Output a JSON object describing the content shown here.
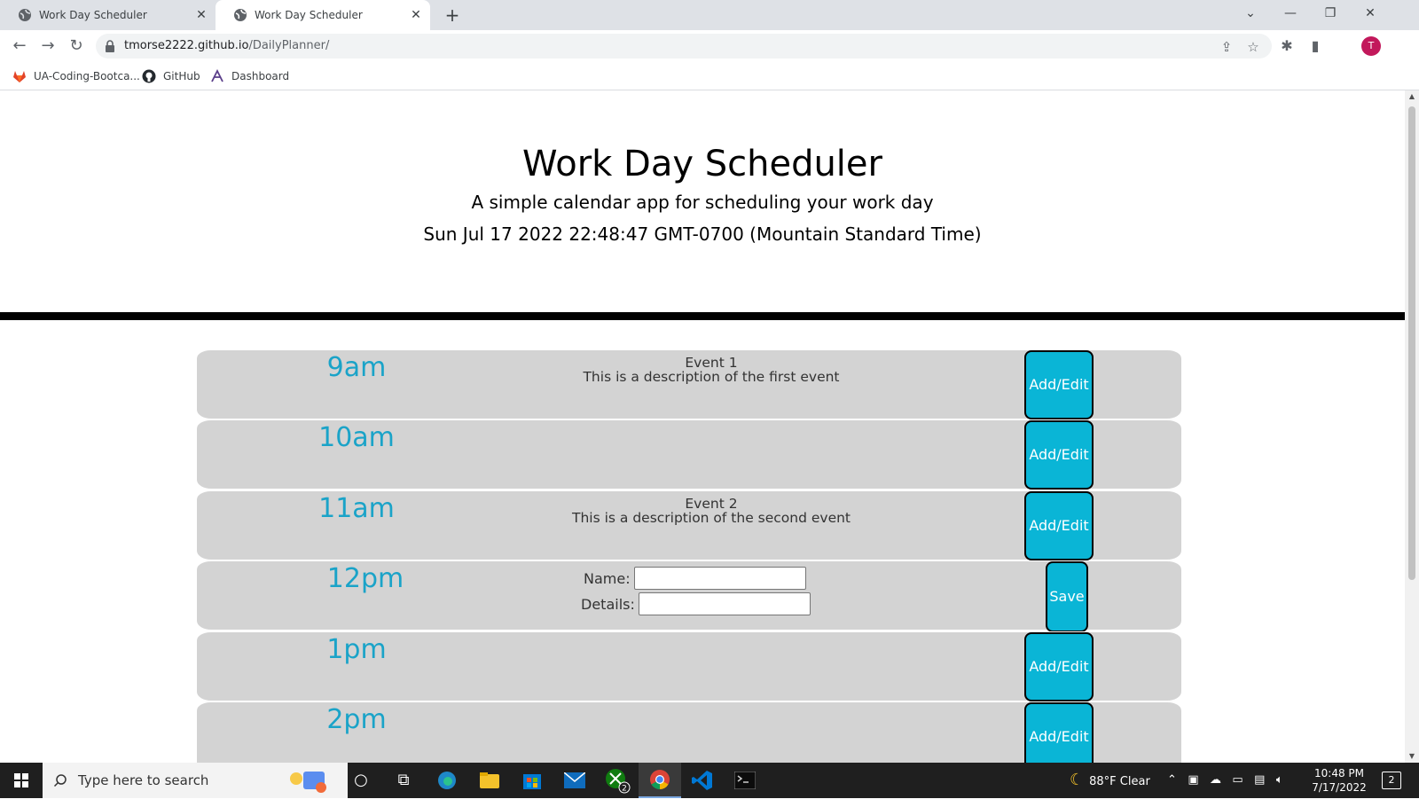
{
  "browser": {
    "tabs": [
      {
        "title": "Work Day Scheduler",
        "active": false
      },
      {
        "title": "Work Day Scheduler",
        "active": true
      }
    ],
    "url_host": "tmorse2222.github.io",
    "url_path": "/DailyPlanner/",
    "avatar_letter": "T",
    "bookmarks": [
      {
        "label": "UA-Coding-Bootca...",
        "icon": "gitlab-icon"
      },
      {
        "label": "GitHub",
        "icon": "github-icon"
      },
      {
        "label": "Dashboard",
        "icon": "dashboard-icon"
      }
    ]
  },
  "page": {
    "title": "Work Day Scheduler",
    "lead": "A simple calendar app for scheduling your work day",
    "current_day": "Sun Jul 17 2022 22:48:47 GMT-0700 (Mountain Standard Time)"
  },
  "schedule": [
    {
      "hour": "9am",
      "event_title": "Event 1",
      "event_desc": "This is a description of the first event",
      "button": "Add/Edit"
    },
    {
      "hour": "10am",
      "event_title": "",
      "event_desc": "",
      "button": "Add/Edit"
    },
    {
      "hour": "11am",
      "event_title": "Event 2",
      "event_desc": "This is a description of the second event",
      "button": "Add/Edit"
    },
    {
      "hour": "12pm",
      "editing": true,
      "name_label": "Name:",
      "details_label": "Details:",
      "name_value": "",
      "details_value": "",
      "button": "Save"
    },
    {
      "hour": "1pm",
      "event_title": "",
      "event_desc": "",
      "button": "Add/Edit"
    },
    {
      "hour": "2pm",
      "event_title": "",
      "event_desc": "",
      "button": "Add/Edit"
    }
  ],
  "taskbar": {
    "search_placeholder": "Type here to search",
    "weather": "88°F  Clear",
    "time": "10:48 PM",
    "date": "7/17/2022",
    "notifications": "2",
    "xbox_badge": "2"
  },
  "colors": {
    "hour_text": "#1aa3c8",
    "button_bg": "#0ab5d6",
    "row_bg": "#d3d3d3"
  }
}
